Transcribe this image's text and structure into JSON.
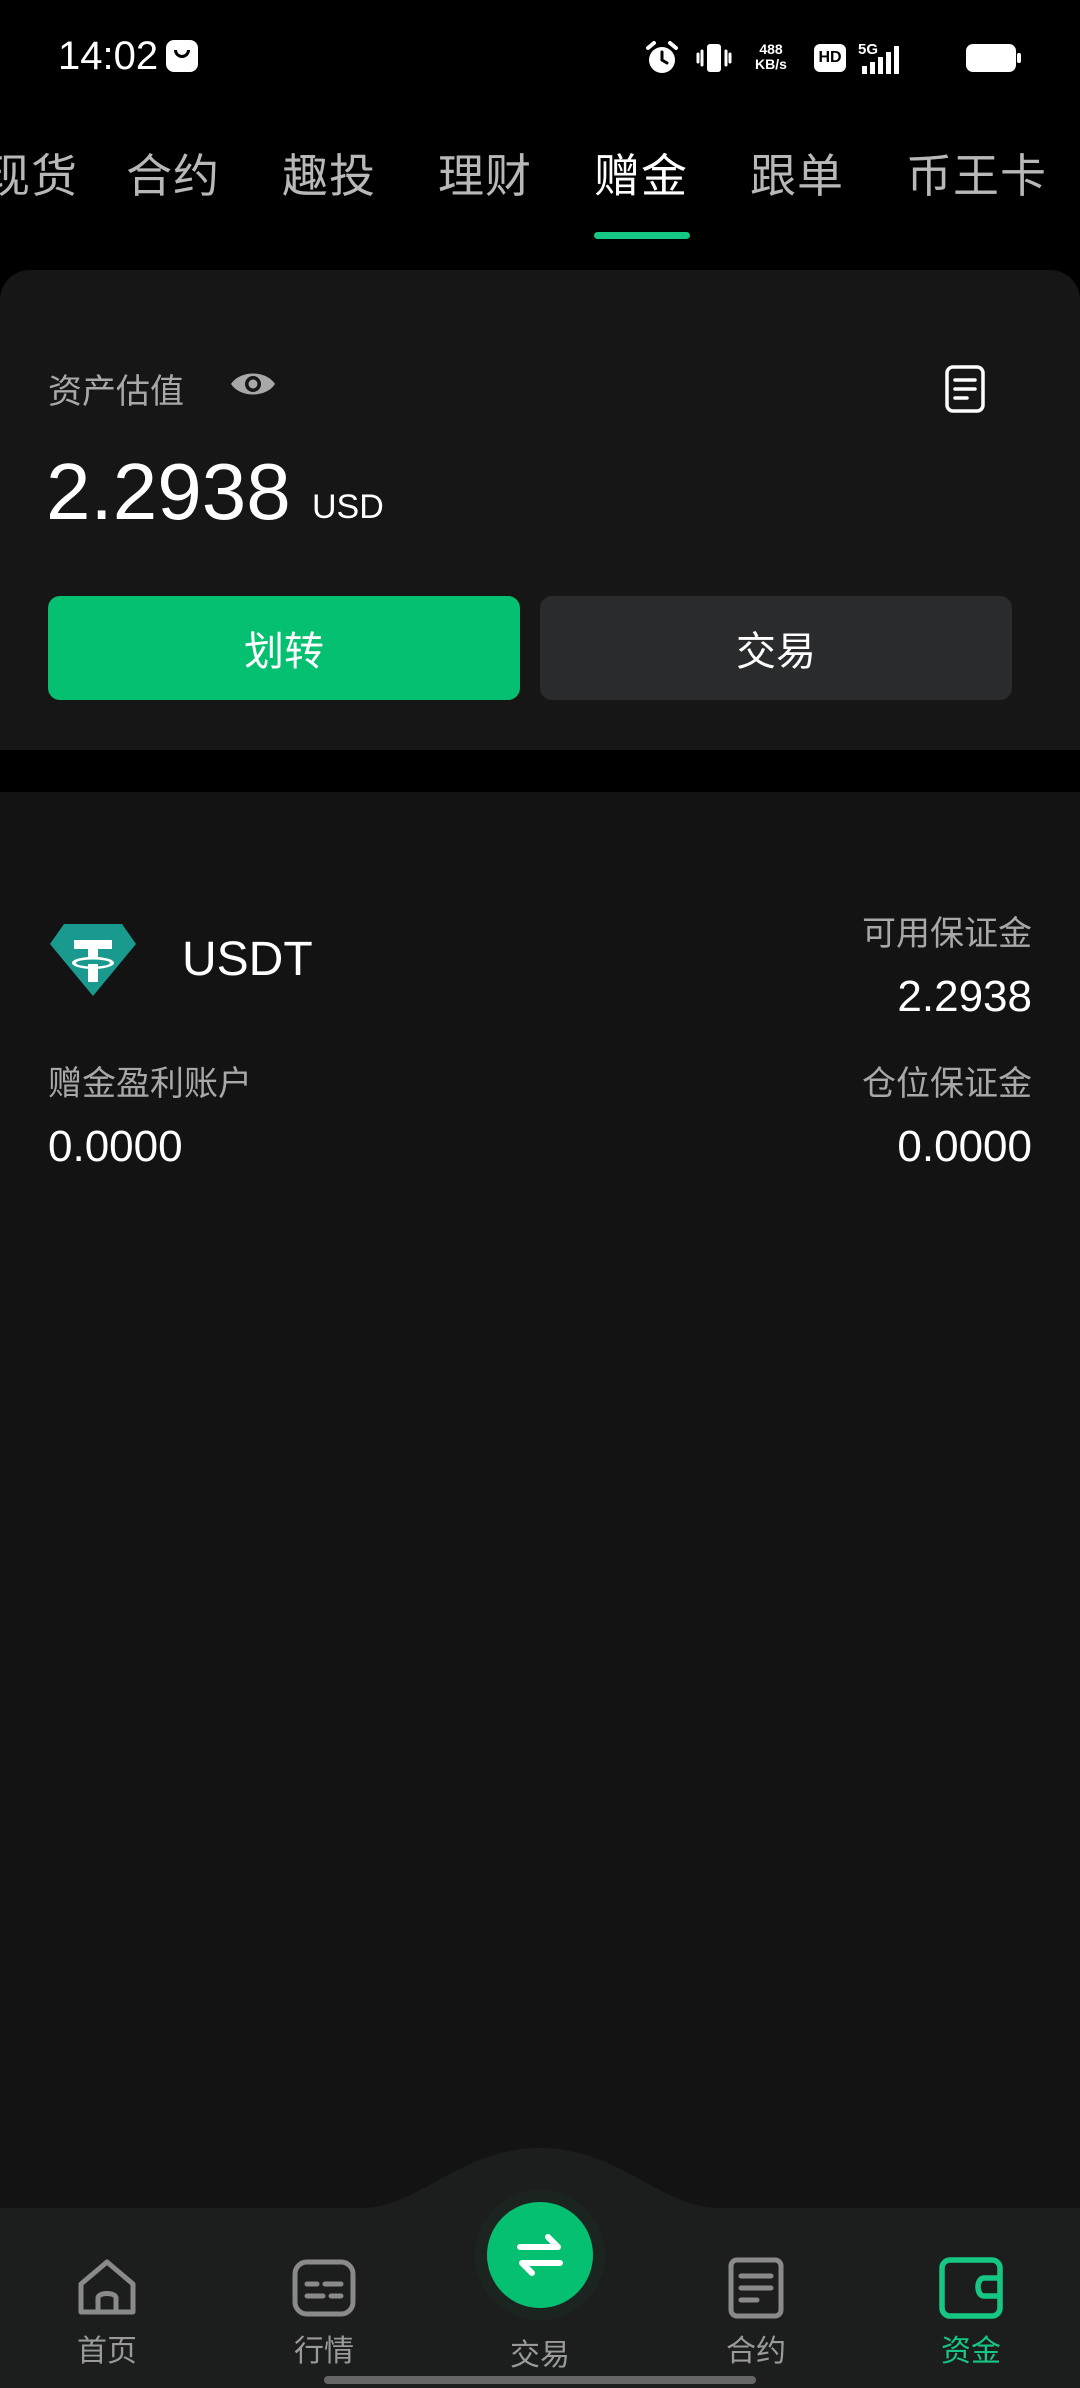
{
  "status_bar": {
    "time": "14:02",
    "net_speed_value": "488",
    "net_speed_unit": "KB/s",
    "hd": "HD",
    "network": "5G"
  },
  "tabs": [
    {
      "label": "现货"
    },
    {
      "label": "合约"
    },
    {
      "label": "趣投"
    },
    {
      "label": "理财"
    },
    {
      "label": "赠金",
      "active": true
    },
    {
      "label": "跟单"
    },
    {
      "label": "币王卡"
    }
  ],
  "asset": {
    "label": "资产估值",
    "value": "2.2938",
    "unit": "USD",
    "transfer_label": "划转",
    "trade_label": "交易"
  },
  "account": {
    "coin": "USDT",
    "available_label": "可用保证金",
    "available_value": "2.2938",
    "bonus_label": "赠金盈利账户",
    "bonus_value": "0.0000",
    "position_label": "仓位保证金",
    "position_value": "0.0000"
  },
  "bottom_nav": {
    "home": "首页",
    "markets": "行情",
    "trade": "交易",
    "futures": "合约",
    "assets": "资金"
  },
  "colors": {
    "accent": "#06c072",
    "tether": "#1a9a8e"
  }
}
